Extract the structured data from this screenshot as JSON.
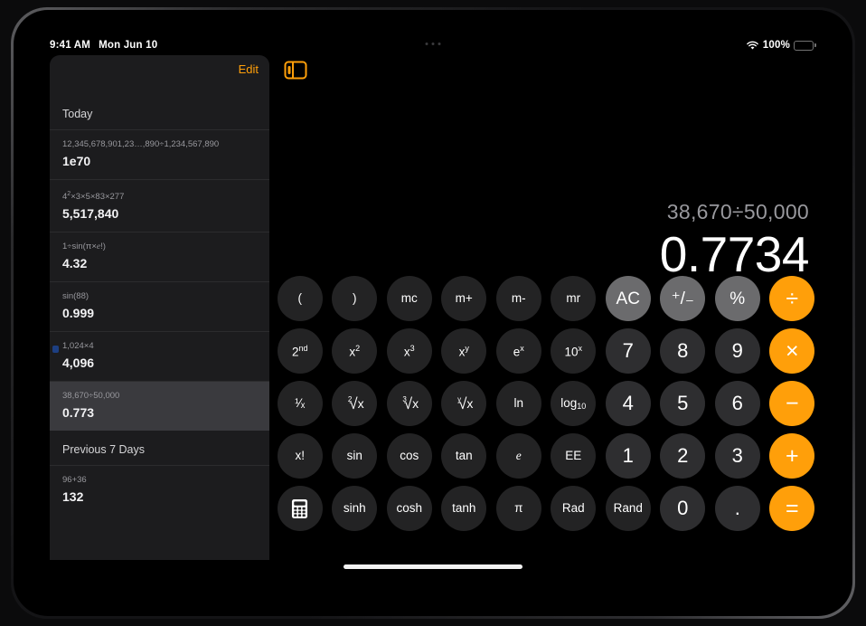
{
  "status_bar": {
    "time": "9:41 AM",
    "date": "Mon Jun 10",
    "battery_percent": "100%",
    "wifi_icon": "wifi-icon",
    "battery_icon": "battery-icon",
    "camera_dots_icon": "camera-dots-icon"
  },
  "sidebar": {
    "edit_label": "Edit",
    "toggle_icon": "sidebar-toggle-icon",
    "sections": [
      {
        "header": "Today",
        "rows": [
          {
            "expression": "12,345,678,901,23…,890÷1,234,567,890",
            "result": "1e70",
            "selected": false
          },
          {
            "expression": "4²×3×5×83×277",
            "result": "5,517,840",
            "selected": false
          },
          {
            "expression": "1÷sin(π×e!)",
            "result": "4.32",
            "selected": false
          },
          {
            "expression": "sin(88)",
            "result": "0.999",
            "selected": false
          },
          {
            "expression": "1,024×4",
            "result": "4,096",
            "selected": false
          },
          {
            "expression": "38,670÷50,000",
            "result": "0.773",
            "selected": true
          }
        ]
      },
      {
        "header": "Previous 7 Days",
        "rows": [
          {
            "expression": "96+36",
            "result": "132",
            "selected": false
          }
        ]
      }
    ]
  },
  "display": {
    "expression": "38,670÷50,000",
    "result": "0.7734"
  },
  "keypad": {
    "rows": [
      [
        {
          "label": "(",
          "name": "key-open-paren",
          "style": "fn"
        },
        {
          "label": ")",
          "name": "key-close-paren",
          "style": "fn"
        },
        {
          "label": "mc",
          "name": "key-memory-clear",
          "style": "fn"
        },
        {
          "label": "m+",
          "name": "key-memory-add",
          "style": "fn"
        },
        {
          "label": "m-",
          "name": "key-memory-subtract",
          "style": "fn"
        },
        {
          "label": "mr",
          "name": "key-memory-recall",
          "style": "fn"
        },
        {
          "label": "AC",
          "name": "key-all-clear",
          "style": "util"
        },
        {
          "label": "⁺/₋",
          "name": "key-plus-minus",
          "style": "util"
        },
        {
          "label": "%",
          "name": "key-percent",
          "style": "util"
        },
        {
          "label": "÷",
          "name": "key-divide",
          "style": "accent"
        }
      ],
      [
        {
          "label": "2nd",
          "name": "key-second-function",
          "style": "fn",
          "sup": "nd",
          "base": "2"
        },
        {
          "label": "x²",
          "name": "key-square",
          "style": "fn",
          "sup": "2",
          "base": "x"
        },
        {
          "label": "x³",
          "name": "key-cube",
          "style": "fn",
          "sup": "3",
          "base": "x"
        },
        {
          "label": "xʸ",
          "name": "key-power-y",
          "style": "fn",
          "sup": "y",
          "base": "x"
        },
        {
          "label": "eˣ",
          "name": "key-exp-e",
          "style": "fn",
          "sup": "x",
          "base": "e"
        },
        {
          "label": "10ˣ",
          "name": "key-exp-ten",
          "style": "fn",
          "sup": "x",
          "base": "10"
        },
        {
          "label": "7",
          "name": "key-7",
          "style": "digit"
        },
        {
          "label": "8",
          "name": "key-8",
          "style": "digit"
        },
        {
          "label": "9",
          "name": "key-9",
          "style": "digit"
        },
        {
          "label": "×",
          "name": "key-multiply",
          "style": "accent"
        }
      ],
      [
        {
          "label": "¹⁄ₓ",
          "name": "key-reciprocal",
          "style": "fn"
        },
        {
          "label": "²√x",
          "name": "key-square-root",
          "style": "fn",
          "index": "2"
        },
        {
          "label": "³√x",
          "name": "key-cube-root",
          "style": "fn",
          "index": "3"
        },
        {
          "label": "ʸ√x",
          "name": "key-nth-root",
          "style": "fn",
          "index": "y"
        },
        {
          "label": "ln",
          "name": "key-natural-log",
          "style": "fn"
        },
        {
          "label": "log₁₀",
          "name": "key-log-base-10",
          "style": "fn",
          "base": "log",
          "sub": "10"
        },
        {
          "label": "4",
          "name": "key-4",
          "style": "digit"
        },
        {
          "label": "5",
          "name": "key-5",
          "style": "digit"
        },
        {
          "label": "6",
          "name": "key-6",
          "style": "digit"
        },
        {
          "label": "−",
          "name": "key-subtract",
          "style": "accent"
        }
      ],
      [
        {
          "label": "x!",
          "name": "key-factorial",
          "style": "fn"
        },
        {
          "label": "sin",
          "name": "key-sine",
          "style": "fn"
        },
        {
          "label": "cos",
          "name": "key-cosine",
          "style": "fn"
        },
        {
          "label": "tan",
          "name": "key-tangent",
          "style": "fn"
        },
        {
          "label": "e",
          "name": "key-euler",
          "style": "fn",
          "italic": true
        },
        {
          "label": "EE",
          "name": "key-scientific-notation",
          "style": "fn"
        },
        {
          "label": "1",
          "name": "key-1",
          "style": "digit"
        },
        {
          "label": "2",
          "name": "key-2",
          "style": "digit"
        },
        {
          "label": "3",
          "name": "key-3",
          "style": "digit"
        },
        {
          "label": "+",
          "name": "key-add",
          "style": "accent"
        }
      ],
      [
        {
          "label": "",
          "name": "key-calculator-mode",
          "style": "fn",
          "icon": "calculator-icon"
        },
        {
          "label": "sinh",
          "name": "key-hyperbolic-sine",
          "style": "fn"
        },
        {
          "label": "cosh",
          "name": "key-hyperbolic-cosine",
          "style": "fn"
        },
        {
          "label": "tanh",
          "name": "key-hyperbolic-tangent",
          "style": "fn"
        },
        {
          "label": "π",
          "name": "key-pi",
          "style": "fn"
        },
        {
          "label": "Rad",
          "name": "key-radians",
          "style": "fn"
        },
        {
          "label": "Rand",
          "name": "key-random",
          "style": "fn"
        },
        {
          "label": "0",
          "name": "key-0",
          "style": "digit"
        },
        {
          "label": ".",
          "name": "key-decimal-point",
          "style": "digit"
        },
        {
          "label": "=",
          "name": "key-equals",
          "style": "accent"
        }
      ]
    ]
  },
  "colors": {
    "accent": "#ff9f0a",
    "screen_background": "#000000",
    "sidebar_background": "#1c1c1e",
    "key_function": "#232324",
    "key_digit": "#2e2e30",
    "key_utility": "#6b6b6d",
    "selected_row": "#3a3a3e"
  },
  "home_indicator": "home-indicator"
}
